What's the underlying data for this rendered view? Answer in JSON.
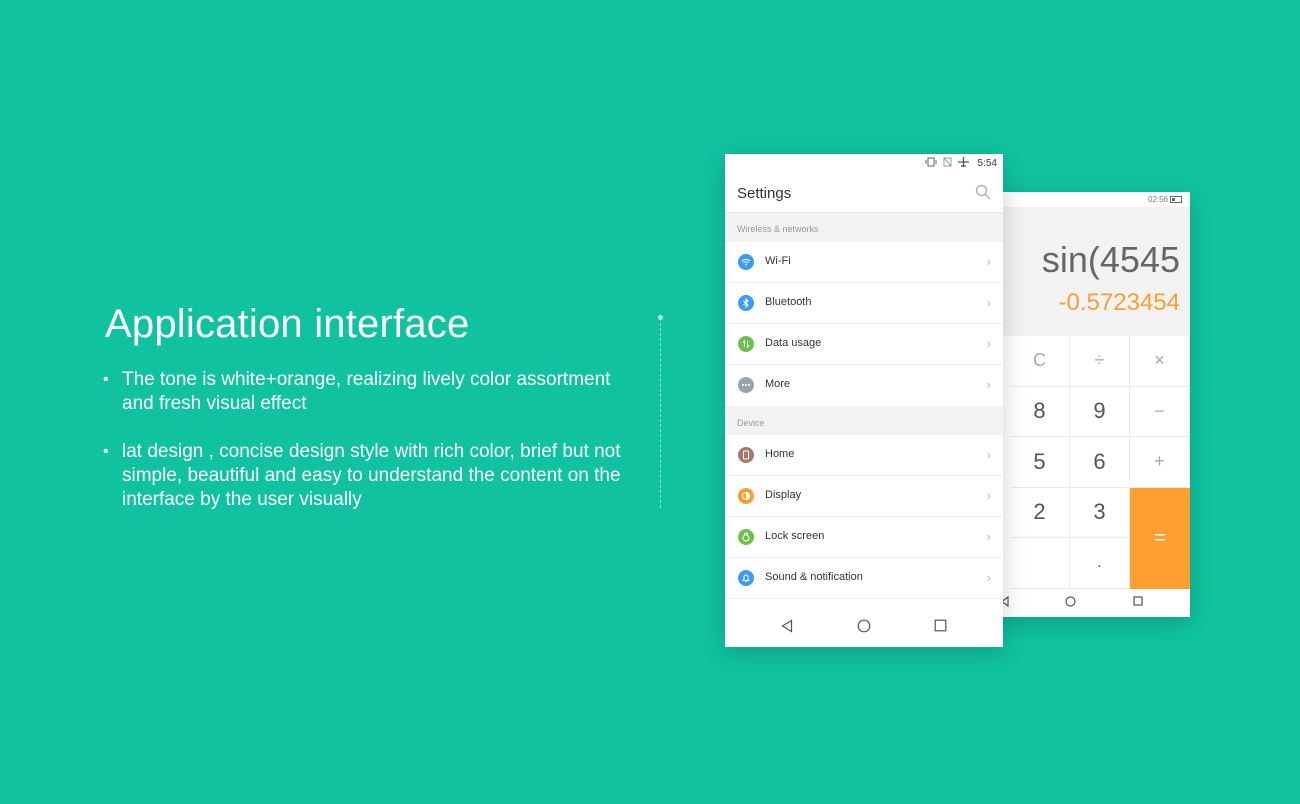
{
  "headline": "Application interface",
  "bullets": [
    "The tone is white+orange, realizing lively color assortment and fresh visual effect",
    "lat design , concise design style with rich color, brief but not simple, beautiful and easy to understand the content on the interface by the user visually"
  ],
  "bullet_char": "•",
  "settings": {
    "time": "5:54",
    "status_icons": [
      "vibrate-icon",
      "no-sim-icon",
      "airplane-icon"
    ],
    "title": "Settings",
    "sections": [
      {
        "header": "Wireless & networks",
        "items": [
          {
            "label": "Wi-Fi",
            "icon": "wifi-icon",
            "color": "#3d9bf5"
          },
          {
            "label": "Bluetooth",
            "icon": "bluetooth-icon",
            "color": "#3d9bf5"
          },
          {
            "label": "Data usage",
            "icon": "data-usage-icon",
            "color": "#6cc04a"
          },
          {
            "label": "More",
            "icon": "more-icon",
            "color": "#9aa3b0"
          }
        ]
      },
      {
        "header": "Device",
        "items": [
          {
            "label": "Home",
            "icon": "home-icon",
            "color": "#a27b6e"
          },
          {
            "label": "Display",
            "icon": "display-icon",
            "color": "#f7a035"
          },
          {
            "label": "Lock screen",
            "icon": "lock-icon",
            "color": "#6cc04a"
          },
          {
            "label": "Sound & notification",
            "icon": "bell-icon",
            "color": "#3d9bf5"
          }
        ]
      }
    ],
    "chevron": "›"
  },
  "calculator": {
    "time": "02:56",
    "expression": "sin(4545",
    "result": "-0.5723454",
    "keys": {
      "clear": "C",
      "divide": "÷",
      "multiply": "×",
      "eight": "8",
      "nine": "9",
      "minus": "−",
      "five": "5",
      "six": "6",
      "plus": "+",
      "two": "2",
      "three": "3",
      "equals": "=",
      "dot": "."
    },
    "accent": "#ff9f32",
    "result_color": "#f7a035"
  },
  "background": "#10c2a0"
}
